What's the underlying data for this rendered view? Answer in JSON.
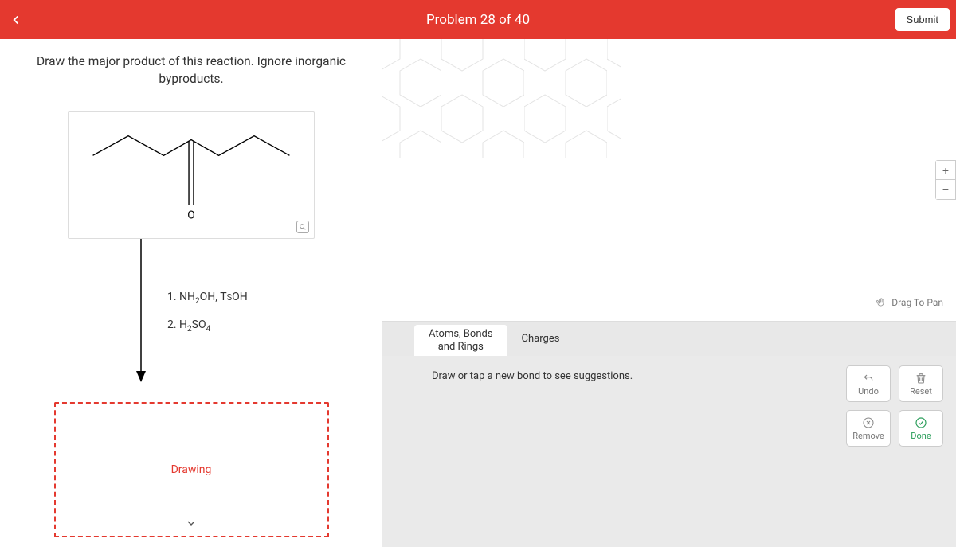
{
  "header": {
    "title": "Problem 28 of 40",
    "submit": "Submit"
  },
  "instruction": "Draw the major product of this reaction. Ignore inorganic byproducts.",
  "molecule": {
    "atom_label": "O"
  },
  "reagents": {
    "line1_prefix": "1. NH",
    "line1_sub1": "2",
    "line1_mid": "OH, T",
    "line1_small": "S",
    "line1_end": "OH",
    "line2_prefix": "2. H",
    "line2_sub1": "2",
    "line2_mid": "SO",
    "line2_sub2": "4"
  },
  "drawing_label": "Drawing",
  "canvas": {
    "drag_hint": "Drag To Pan"
  },
  "tabs": {
    "atoms_bonds": "Atoms, Bonds\nand Rings",
    "charges": "Charges"
  },
  "hint": "Draw or tap a new bond to see suggestions.",
  "actions": {
    "undo": "Undo",
    "reset": "Reset",
    "remove": "Remove",
    "done": "Done"
  }
}
